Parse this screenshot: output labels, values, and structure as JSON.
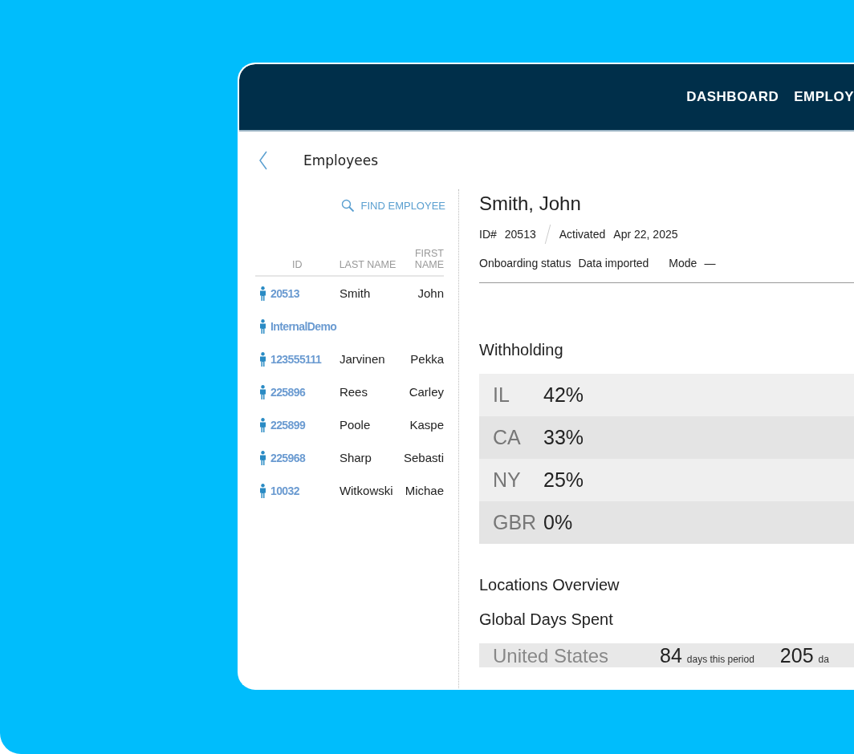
{
  "nav": [
    {
      "label": "DASHBOARD"
    },
    {
      "label": "EMPLOY"
    }
  ],
  "page_title": "Employees",
  "find_employee": "FIND EMPLOYEE",
  "table": {
    "columns": [
      "ID",
      "LAST NAME",
      "FIRST NAME"
    ],
    "rows": [
      {
        "id": "20513",
        "last": "Smith",
        "first": "John"
      },
      {
        "id": "InternalDemo",
        "last": "",
        "first": ""
      },
      {
        "id": "123555111",
        "last": "Jarvinen",
        "first": "Pekka"
      },
      {
        "id": "225896",
        "last": "Rees",
        "first": "Carley"
      },
      {
        "id": "225899",
        "last": "Poole",
        "first": "Kaspe"
      },
      {
        "id": "225968",
        "last": "Sharp",
        "first": "Sebasti"
      },
      {
        "id": "10032",
        "last": "Witkowski",
        "first": "Michae"
      }
    ]
  },
  "employee": {
    "name": "Smith, John",
    "id_label": "ID#",
    "id": "20513",
    "status": "Activated",
    "date": "Apr 22, 2025",
    "onboarding_label": "Onboarding status",
    "onboarding_value": "Data imported",
    "mode_label": "Mode",
    "mode_value": "—"
  },
  "withholding": {
    "title": "Withholding",
    "rows": [
      {
        "region": "IL",
        "percent": "42%"
      },
      {
        "region": "CA",
        "percent": "33%"
      },
      {
        "region": "NY",
        "percent": "25%"
      },
      {
        "region": "GBR",
        "percent": "0%"
      }
    ]
  },
  "locations_title": "Locations Overview",
  "days_title": "Global Days Spent",
  "days_rows": [
    {
      "country": "United States",
      "days": "84",
      "days_label": "days this period",
      "total": "205",
      "total_label": "da"
    }
  ]
}
